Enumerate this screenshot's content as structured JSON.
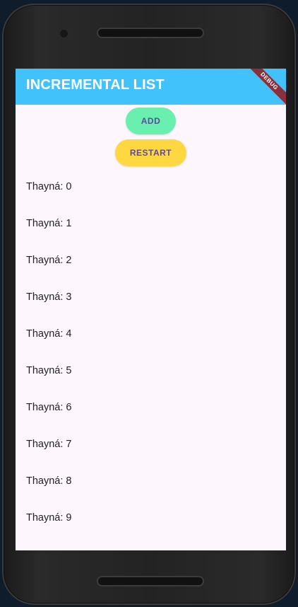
{
  "app": {
    "title": "INCREMENTAL LIST",
    "debug_banner": "DEBUG"
  },
  "buttons": {
    "add_label": "ADD",
    "restart_label": "RESTART"
  },
  "list": {
    "items": [
      "Thayná: 0",
      "Thayná: 1",
      "Thayná: 2",
      "Thayná: 3",
      "Thayná: 4",
      "Thayná: 5",
      "Thayná: 6",
      "Thayná: 7",
      "Thayná: 8",
      "Thayná: 9"
    ]
  },
  "colors": {
    "appbar": "#42c2fb",
    "add_button": "#69f0ae",
    "restart_button": "#ffd740",
    "button_text": "#5b4aa0",
    "screen_background": "#fdf7fd",
    "debug_banner": "#8a2f3b"
  }
}
